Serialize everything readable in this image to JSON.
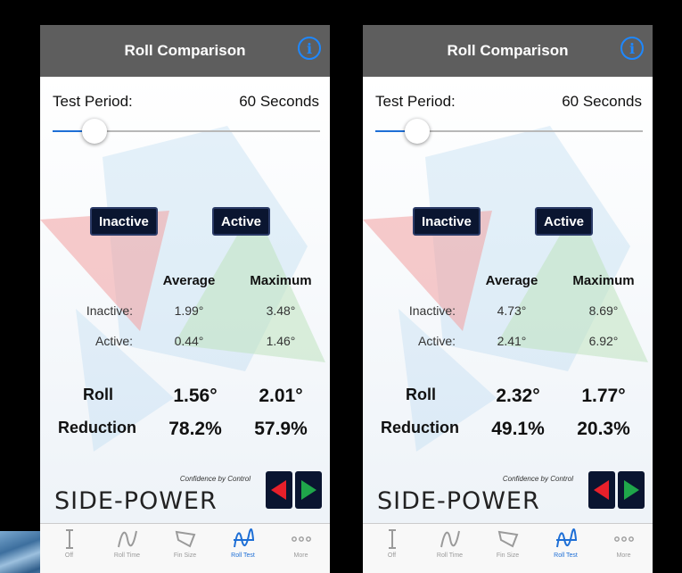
{
  "screens": [
    {
      "title": "Roll Comparison",
      "info_icon": "i",
      "test_period_label": "Test Period:",
      "test_period_value": "60 Seconds",
      "slider_fraction": 0.15,
      "inactive_button": "Inactive",
      "active_button": "Active",
      "col_average": "Average",
      "col_maximum": "Maximum",
      "rows": [
        {
          "label": "Inactive:",
          "average": "1.99°",
          "maximum": "3.48°"
        },
        {
          "label": "Active:",
          "average": "0.44°",
          "maximum": "1.46°"
        }
      ],
      "roll_label": "Roll",
      "reduction_label": "Reduction",
      "roll_average": "1.56°",
      "roll_maximum": "2.01°",
      "reduction_average": "78.2%",
      "reduction_maximum": "57.9%",
      "tagline": "Confidence by Control",
      "brand": "SIDE-POWER",
      "tabs": [
        "Off",
        "Roll Time",
        "Fin Size",
        "Roll Test",
        "More"
      ],
      "selected_tab": 3
    },
    {
      "title": "Roll Comparison",
      "info_icon": "i",
      "test_period_label": "Test Period:",
      "test_period_value": "60 Seconds",
      "slider_fraction": 0.15,
      "inactive_button": "Inactive",
      "active_button": "Active",
      "col_average": "Average",
      "col_maximum": "Maximum",
      "rows": [
        {
          "label": "Inactive:",
          "average": "4.73°",
          "maximum": "8.69°"
        },
        {
          "label": "Active:",
          "average": "2.41°",
          "maximum": "6.92°"
        }
      ],
      "roll_label": "Roll",
      "reduction_label": "Reduction",
      "roll_average": "2.32°",
      "roll_maximum": "1.77°",
      "reduction_average": "49.1%",
      "reduction_maximum": "20.3%",
      "tagline": "Confidence by Control",
      "brand": "SIDE-POWER",
      "tabs": [
        "Off",
        "Roll Time",
        "Fin Size",
        "Roll Test",
        "More"
      ],
      "selected_tab": 3
    }
  ],
  "colors": {
    "nav_bar": "#5e5e5e",
    "accent_blue": "#1e88ff",
    "button_dark": "#0a1530",
    "arrow_red": "#e8202a",
    "arrow_green": "#1fa64a"
  },
  "icons": {
    "tabs": [
      "off-icon",
      "roll-time-icon",
      "fin-size-icon",
      "roll-test-icon",
      "more-icon"
    ]
  }
}
